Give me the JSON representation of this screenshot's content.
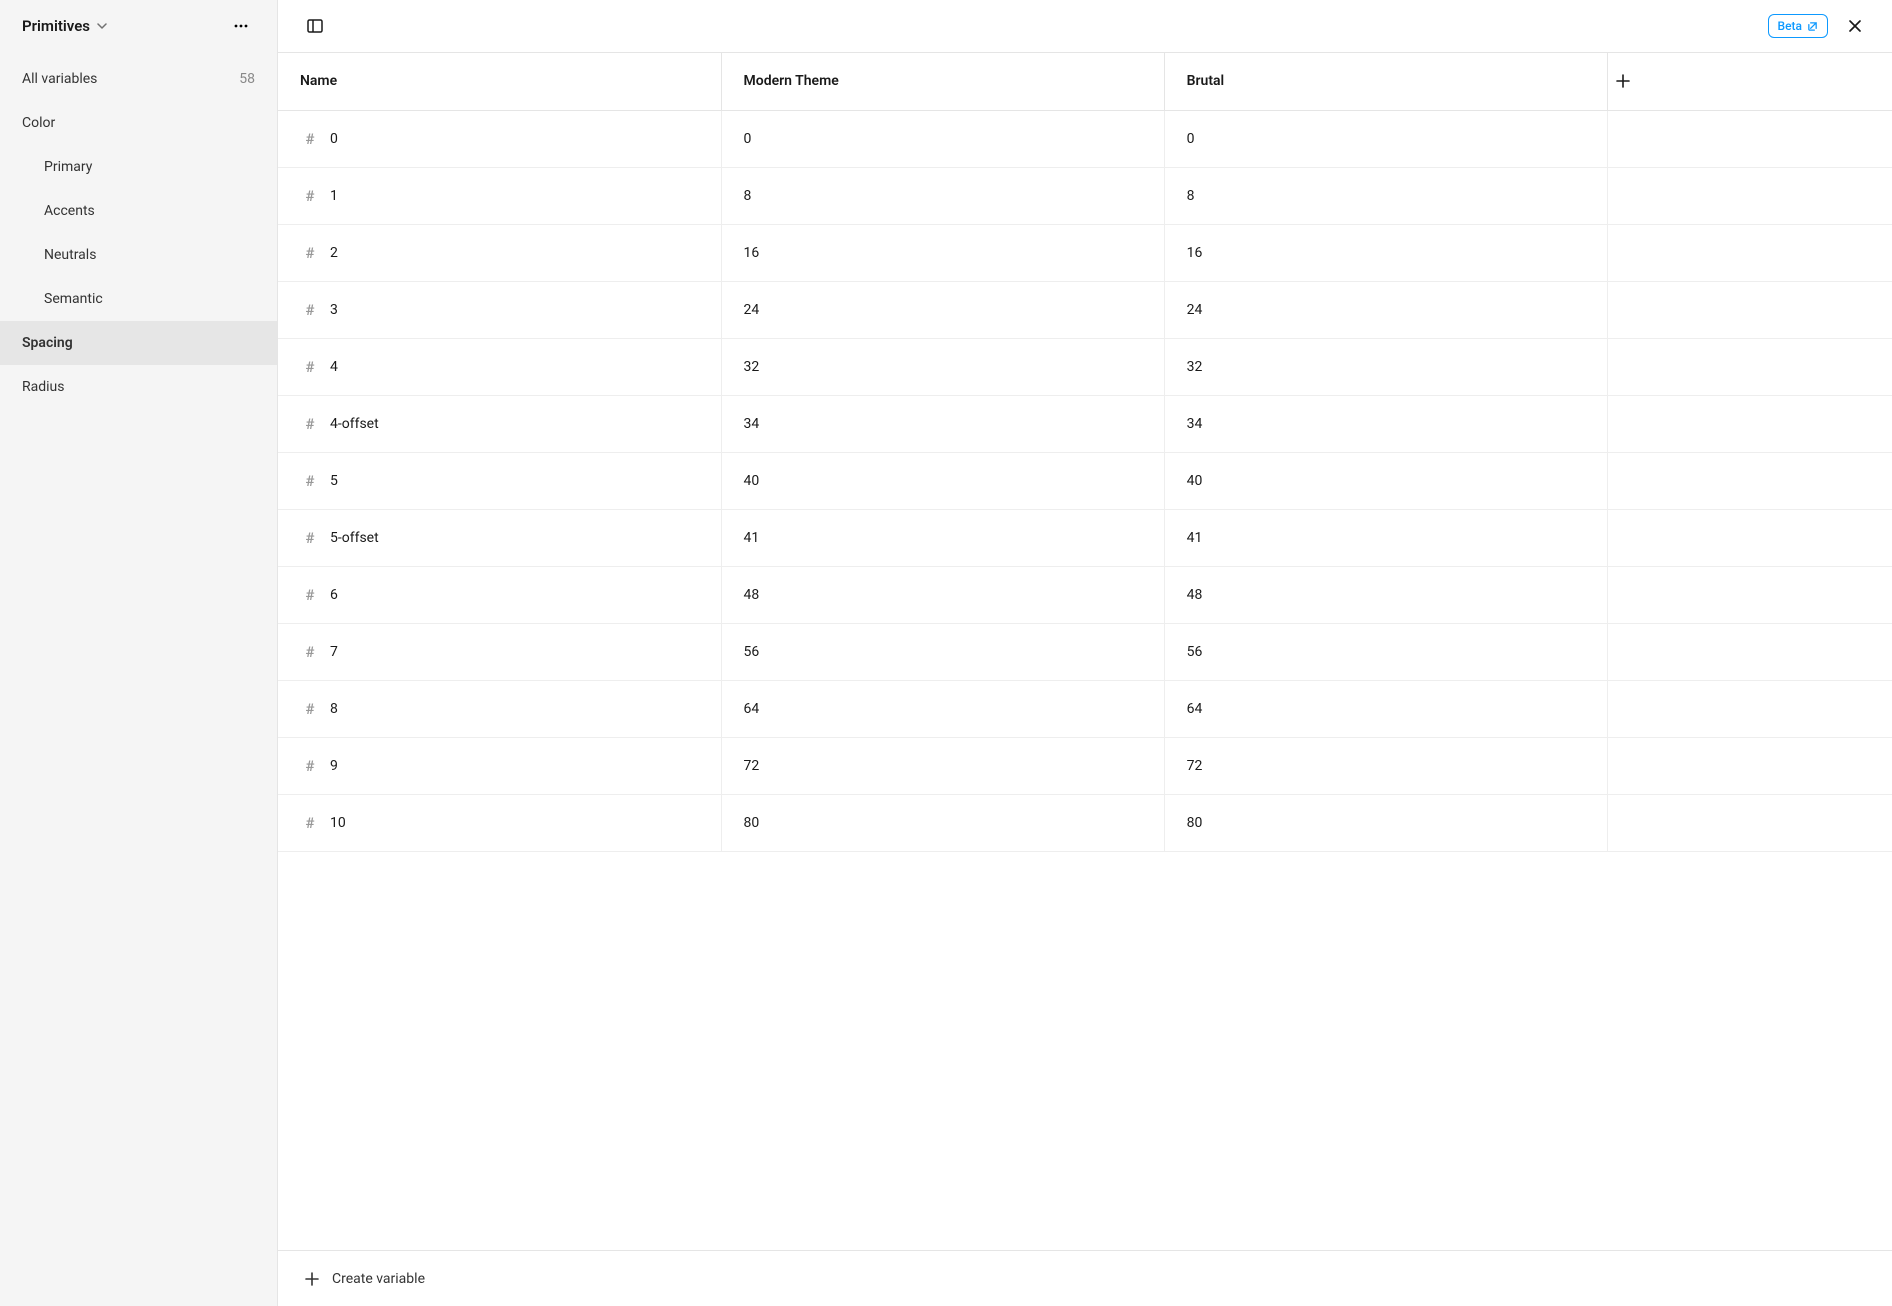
{
  "header": {
    "collection_name": "Primitives",
    "beta_label": "Beta"
  },
  "sidebar": {
    "all_label": "All variables",
    "all_count": "58",
    "groups": [
      {
        "label": "Color",
        "active": false,
        "indent": 0
      },
      {
        "label": "Primary",
        "active": false,
        "indent": 1
      },
      {
        "label": "Accents",
        "active": false,
        "indent": 1
      },
      {
        "label": "Neutrals",
        "active": false,
        "indent": 1
      },
      {
        "label": "Semantic",
        "active": false,
        "indent": 1
      },
      {
        "label": "Spacing",
        "active": true,
        "indent": 0
      },
      {
        "label": "Radius",
        "active": false,
        "indent": 0
      }
    ]
  },
  "table": {
    "columns": {
      "name": "Name",
      "modes": [
        "Modern Theme",
        "Brutal"
      ]
    },
    "rows": [
      {
        "name": "0",
        "values": [
          "0",
          "0"
        ]
      },
      {
        "name": "1",
        "values": [
          "8",
          "8"
        ]
      },
      {
        "name": "2",
        "values": [
          "16",
          "16"
        ]
      },
      {
        "name": "3",
        "values": [
          "24",
          "24"
        ]
      },
      {
        "name": "4",
        "values": [
          "32",
          "32"
        ]
      },
      {
        "name": "4-offset",
        "values": [
          "34",
          "34"
        ]
      },
      {
        "name": "5",
        "values": [
          "40",
          "40"
        ]
      },
      {
        "name": "5-offset",
        "values": [
          "41",
          "41"
        ]
      },
      {
        "name": "6",
        "values": [
          "48",
          "48"
        ]
      },
      {
        "name": "7",
        "values": [
          "56",
          "56"
        ]
      },
      {
        "name": "8",
        "values": [
          "64",
          "64"
        ]
      },
      {
        "name": "9",
        "values": [
          "72",
          "72"
        ]
      },
      {
        "name": "10",
        "values": [
          "80",
          "80"
        ]
      }
    ]
  },
  "footer": {
    "create_label": "Create variable"
  }
}
